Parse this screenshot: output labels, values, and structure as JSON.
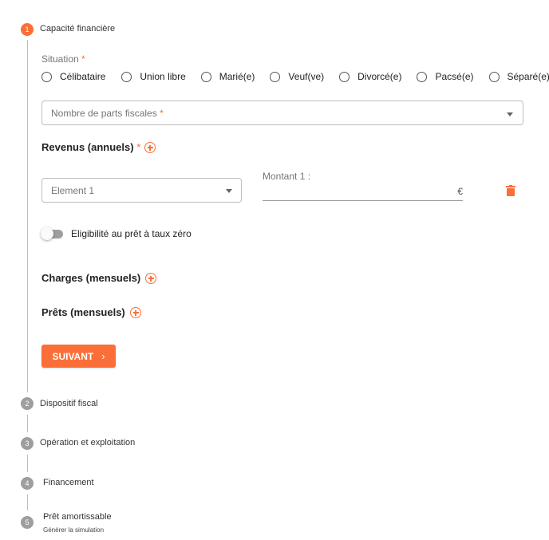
{
  "steps": [
    {
      "number": "1",
      "label": "Capacité financière"
    },
    {
      "number": "2",
      "label": "Dispositif fiscal"
    },
    {
      "number": "3",
      "label": "Opération et exploitation"
    },
    {
      "number": "4",
      "label": "Financement"
    },
    {
      "number": "5",
      "label": "Prêt amortissable",
      "sublabel": "Générer la simulation"
    }
  ],
  "situation": {
    "label": "Situation",
    "required_mark": "*",
    "options": [
      "Célibataire",
      "Union libre",
      "Marié(e)",
      "Veuf(ve)",
      "Divorcé(e)",
      "Pacsé(e)",
      "Séparé(e)"
    ]
  },
  "parts_fiscales": {
    "placeholder": "Nombre de parts fiscales",
    "required_mark": "*"
  },
  "revenus": {
    "title": "Revenus (annuels)",
    "required_mark": "*",
    "element_select": "Element 1",
    "amount_label": "Montant 1 :",
    "amount_value": "",
    "currency": "€"
  },
  "ptz": {
    "label": "Eligibilité au prêt à taux zéro",
    "enabled": false
  },
  "charges": {
    "title": "Charges (mensuels)"
  },
  "prets": {
    "title": "Prêts (mensuels)"
  },
  "next_button": {
    "label": "SUIVANT",
    "chevron": "›"
  },
  "colors": {
    "accent": "#fc6e37",
    "inactive_step": "#9e9e9e"
  },
  "icons": {
    "add": "plus-circle-icon",
    "delete": "trash-icon",
    "dropdown": "caret-down-icon"
  }
}
